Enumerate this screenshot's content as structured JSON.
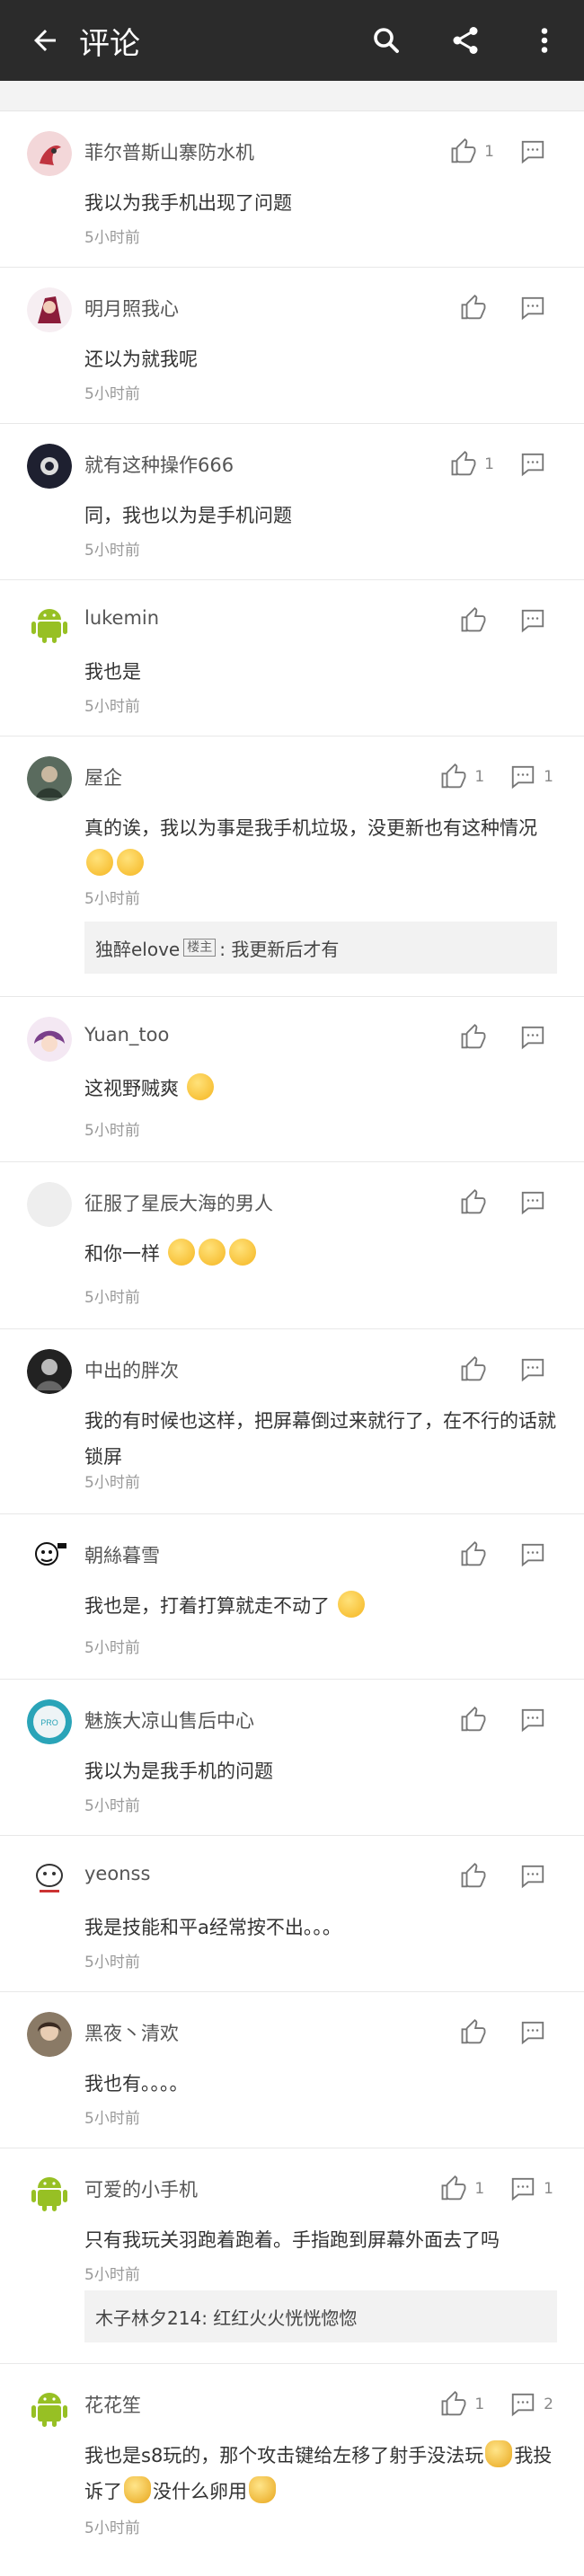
{
  "header": {
    "title": "评论",
    "icons": [
      "back-arrow-icon",
      "search-icon",
      "share-icon",
      "more-vertical-icon"
    ]
  },
  "comments": [
    {
      "user": "菲尔普斯山寨防水机",
      "text": "我以为我手机出现了问题",
      "time": "5小时前",
      "likes": "1",
      "replies": ""
    },
    {
      "user": "明月照我心",
      "text": "还以为就我呢",
      "time": "5小时前",
      "likes": "",
      "replies": ""
    },
    {
      "user": "就有这种操作666",
      "text": "同，我也以为是手机问题",
      "time": "5小时前",
      "likes": "1",
      "replies": ""
    },
    {
      "user": "lukemin",
      "text": "我也是",
      "time": "5小时前",
      "likes": "",
      "replies": ""
    },
    {
      "user": "屋企",
      "text": "真的诶，我以为事是我手机垃圾，没更新也有这种情况",
      "time": "5小时前",
      "likes": "1",
      "replies": "1",
      "reply": {
        "user": "独醉elove",
        "badge": "楼主",
        "text": ": 我更新后才有"
      }
    },
    {
      "user": "Yuan_too",
      "text": "这视野贼爽",
      "time": "5小时前",
      "likes": "",
      "replies": ""
    },
    {
      "user": "征服了星辰大海的男人",
      "text": "和你一样",
      "time": "5小时前",
      "likes": "",
      "replies": ""
    },
    {
      "user": "中出的胖次",
      "text": "我的有时候也这样，把屏幕倒过来就行了，在不行的话就锁屏",
      "time": "5小时前",
      "likes": "",
      "replies": ""
    },
    {
      "user": "朝絲暮雪",
      "text": "我也是，打着打算就走不动了",
      "time": "5小时前",
      "likes": "",
      "replies": ""
    },
    {
      "user": "魅族大凉山售后中心",
      "text": "我以为是我手机的问题",
      "time": "5小时前",
      "likes": "",
      "replies": ""
    },
    {
      "user": "yeonss",
      "text": "我是技能和平a经常按不出。。。",
      "time": "5小时前",
      "likes": "",
      "replies": ""
    },
    {
      "user": "黑夜丶清欢",
      "text": "我也有。。。。",
      "time": "5小时前",
      "likes": "",
      "replies": ""
    },
    {
      "user": "可爱的小手机",
      "text": "只有我玩关羽跑着跑着。手指跑到屏幕外面去了吗",
      "time": "5小时前",
      "likes": "1",
      "replies": "1",
      "reply": {
        "user": "木子林夕214",
        "badge": "",
        "text": ": 红红火火恍恍惚惚"
      }
    },
    {
      "user": "花花笙",
      "text_a": "我也是s8玩的，那个攻击键给左移了射手没法玩",
      "text_b": "我投诉了",
      "text_c": "没什么卵用",
      "time": "5小时前",
      "likes": "1",
      "replies": "2"
    }
  ],
  "colors": {
    "topbar": "#2b2b2b",
    "android_green": "#97c024"
  }
}
